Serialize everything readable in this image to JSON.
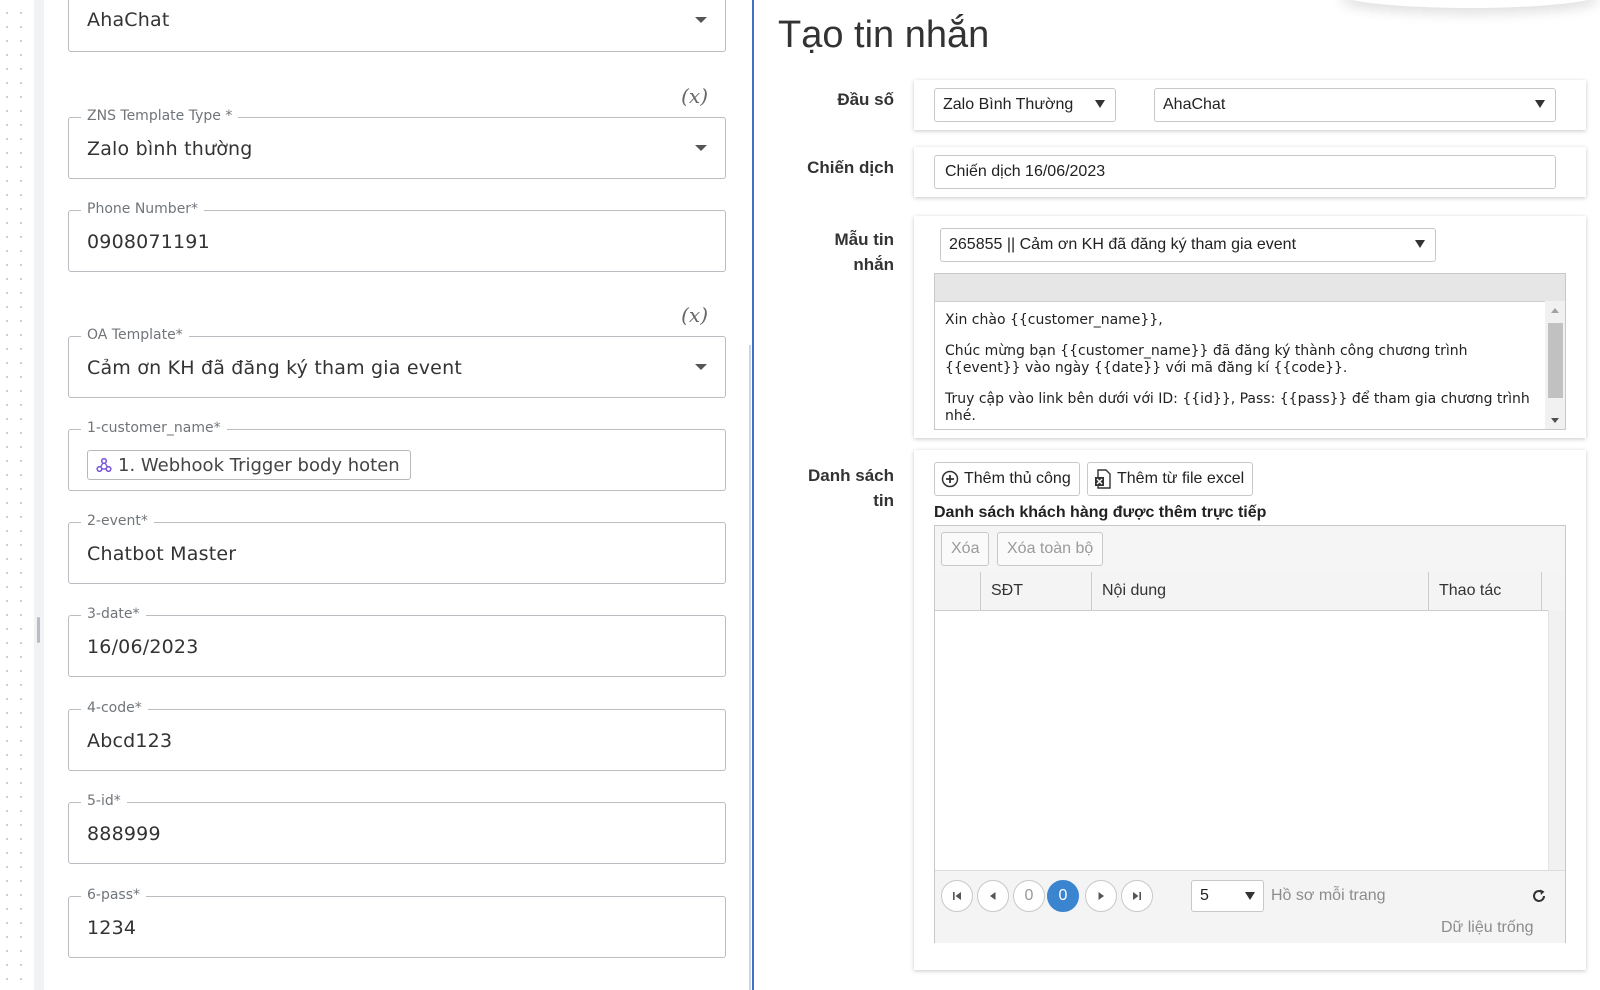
{
  "left_form": {
    "first_select_value": "AhaChat",
    "x_label": "(x)",
    "zns_type": {
      "label": "ZNS Template Type *",
      "value": "Zalo bình thường"
    },
    "phone": {
      "label": "Phone Number*",
      "value": "0908071191"
    },
    "oa_template": {
      "label": "OA Template*",
      "value": "Cảm ơn KH đã đăng ký tham gia event"
    },
    "customer_name": {
      "label": "1-customer_name*",
      "chip": "1. Webhook Trigger body hoten",
      "chip_icon": "webhook-icon"
    },
    "event": {
      "label": "2-event*",
      "value": "Chatbot Master"
    },
    "date": {
      "label": "3-date*",
      "value": "16/06/2023"
    },
    "code": {
      "label": "4-code*",
      "value": "Abcd123"
    },
    "id": {
      "label": "5-id*",
      "value": "888999"
    },
    "pass": {
      "label": "6-pass*",
      "value": "1234"
    }
  },
  "right_panel": {
    "title": "Tạo tin nhắn",
    "dau_so": {
      "label": "Đầu số",
      "type_value": "Zalo Bình Thường",
      "account_value": "AhaChat"
    },
    "chien_dich": {
      "label": "Chiến dịch",
      "value": "Chiến dịch 16/06/2023"
    },
    "mau_tin": {
      "label_line1": "Mẫu tin",
      "label_line2": "nhắn",
      "template_value": "265855 || Cảm ơn KH đã đăng ký tham gia event",
      "preview_lines": [
        "Xin chào {{customer_name}},",
        "Chúc mừng bạn {{customer_name}} đã đăng ký thành công chương trình {{event}} vào ngày {{date}} với mã đăng kí {{code}}.",
        "Truy cập vào link bên dưới với ID: {{id}}, Pass: {{pass}} để tham gia chương trình nhé."
      ]
    },
    "danh_sach": {
      "label_line1": "Danh sách",
      "label_line2": "tin",
      "add_manual": "Thêm thủ công",
      "add_excel": "Thêm từ file excel",
      "subtitle": "Danh sách khách hàng được thêm trực tiếp",
      "delete": "Xóa",
      "delete_all": "Xóa toàn bộ",
      "columns": [
        "SĐT",
        "Nội dung",
        "Thao tác"
      ],
      "pager": {
        "page_left": "0",
        "page_current": "0",
        "page_size": "5",
        "page_size_label": "Hồ sơ mỗi trang",
        "empty": "Dữ liệu trống"
      }
    }
  },
  "colors": {
    "divider": "#3f6fc4",
    "active_page": "#3a84d0"
  }
}
